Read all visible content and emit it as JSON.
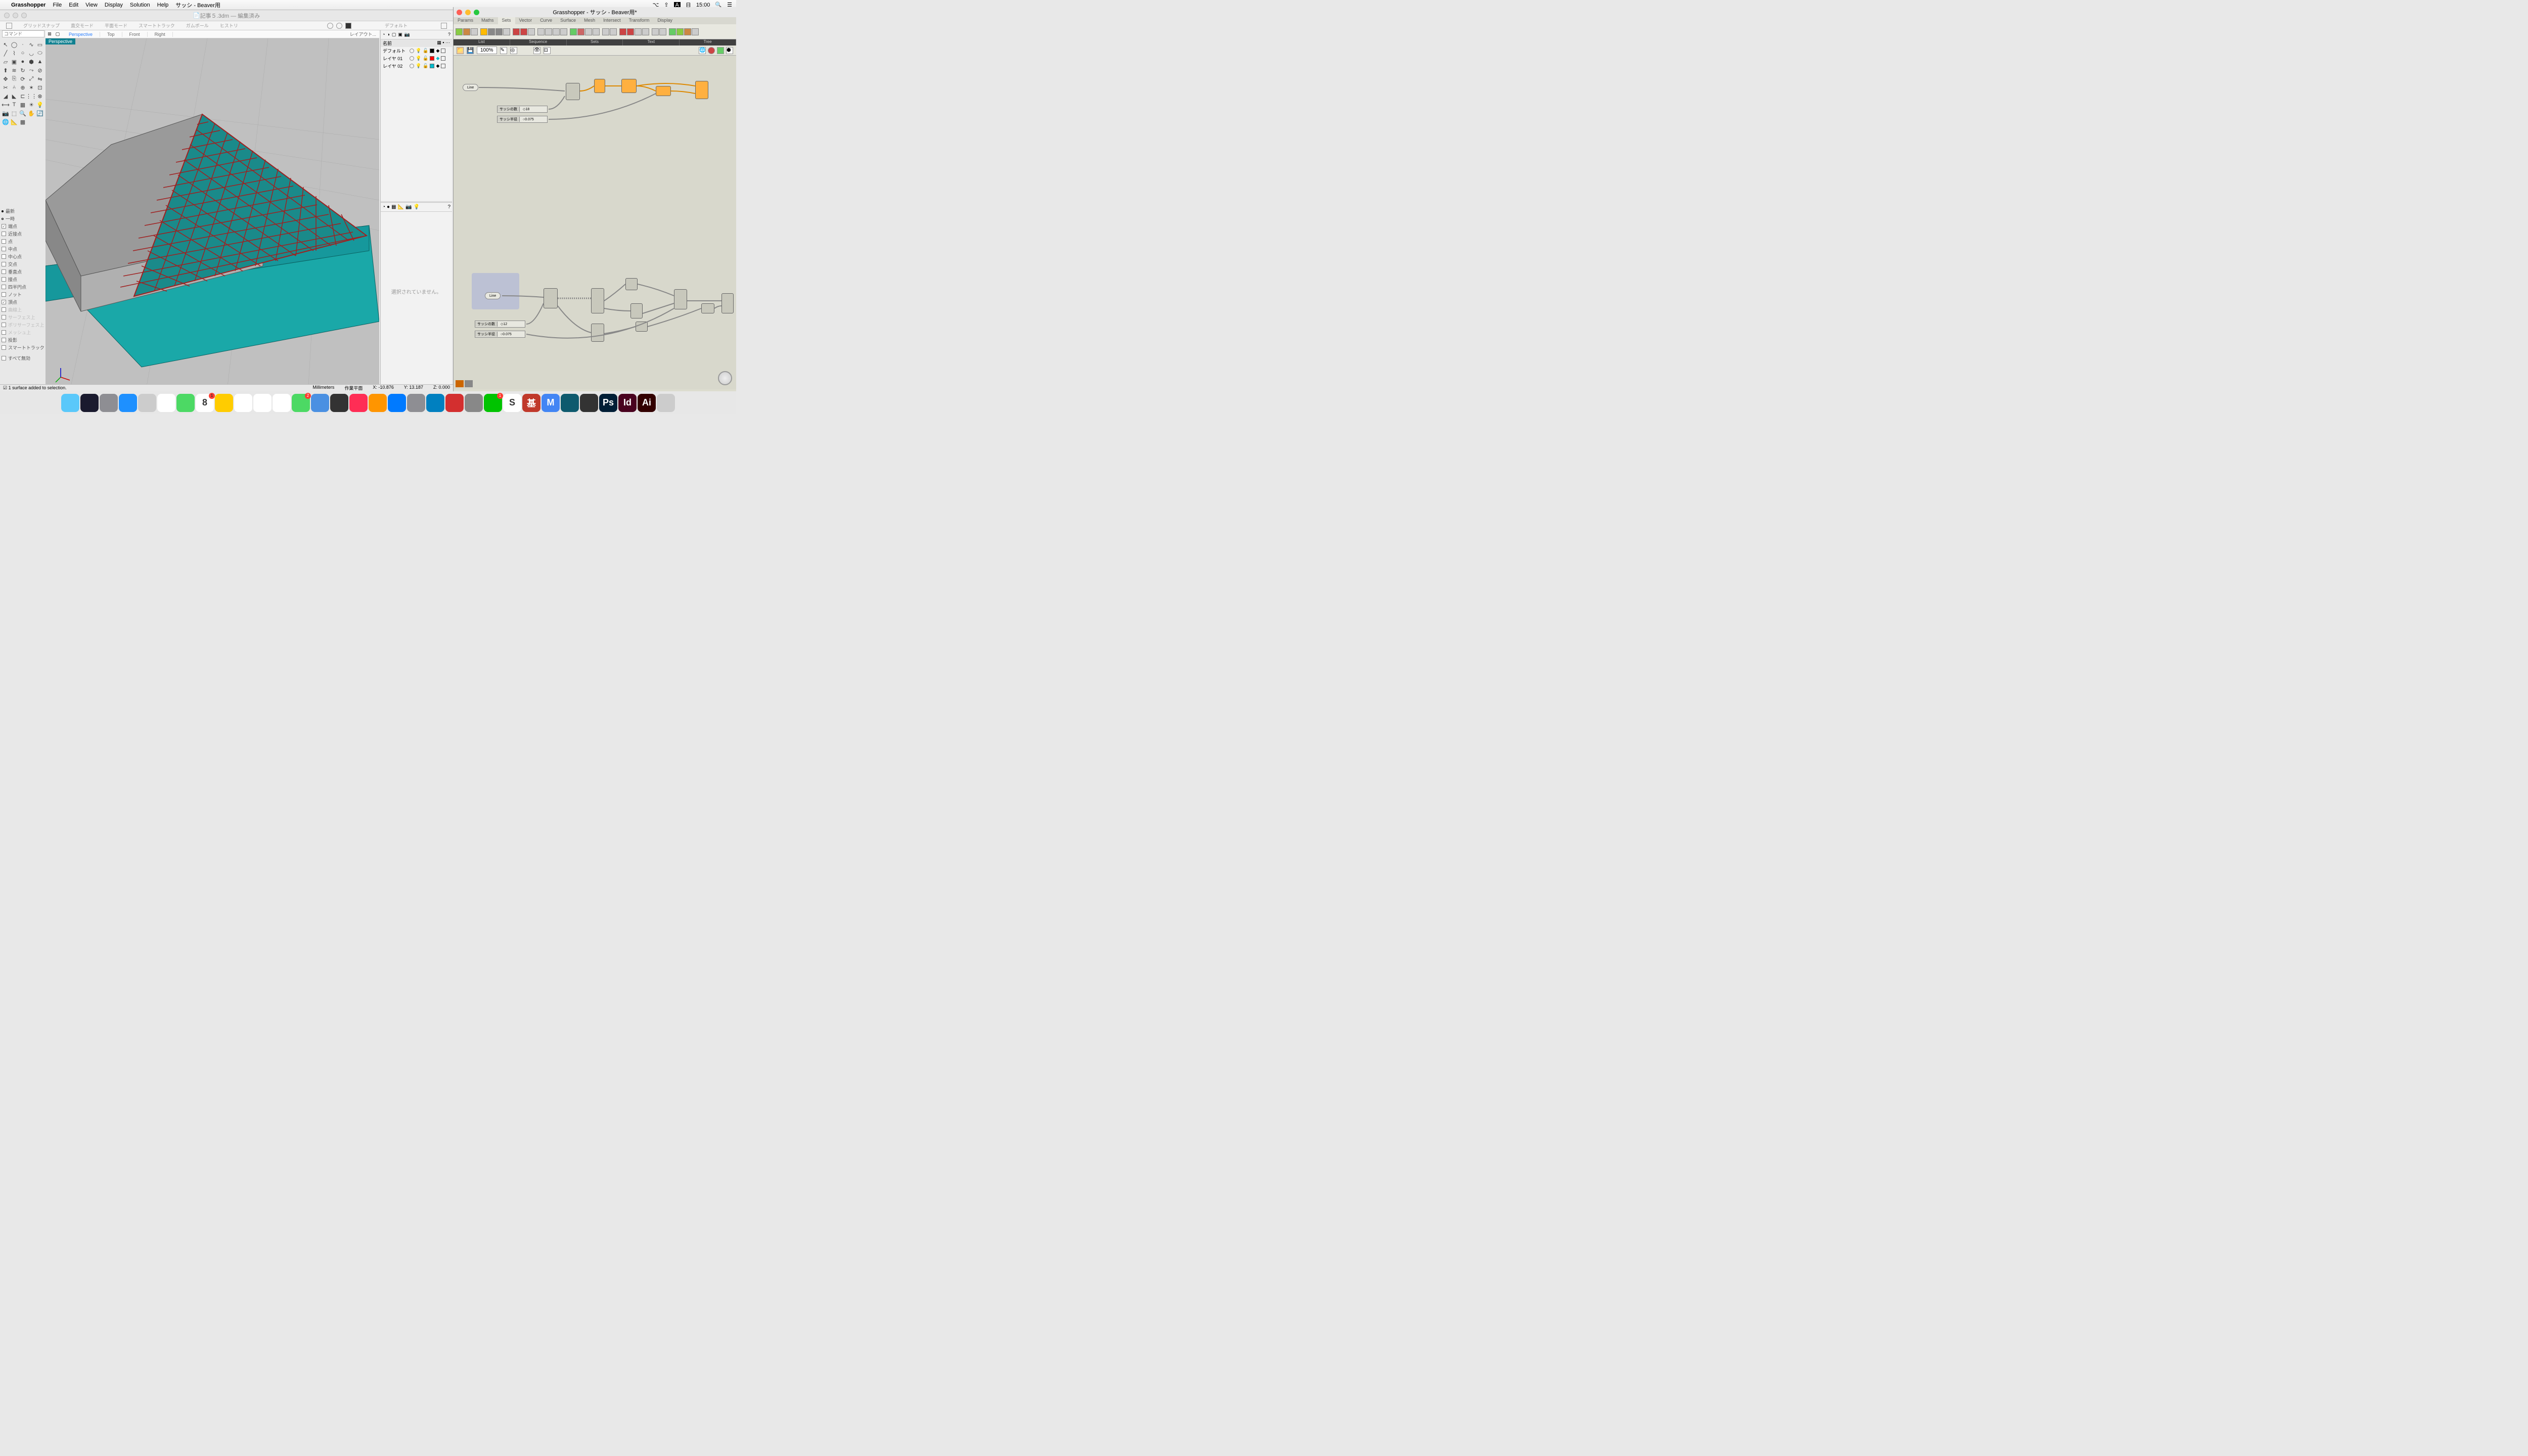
{
  "menubar": {
    "app": "Grasshopper",
    "items": [
      "File",
      "Edit",
      "View",
      "Display",
      "Solution",
      "Help",
      "サッシ - Beaver用"
    ],
    "day": "日",
    "time": "15:00"
  },
  "rhino": {
    "title": "記事５.3dm — 編集済み",
    "opts": [
      "グリッドスナップ",
      "直交モード",
      "平面モード",
      "スマートトラック",
      "ガムボール",
      "ヒストリ"
    ],
    "opts_right": "デフォルト",
    "cmd_placeholder": "コマンド",
    "viewport_label": "Perspective",
    "tabs": [
      "Perspective",
      "Top",
      "Front",
      "Right"
    ],
    "layout": "レイアウト..."
  },
  "layers": {
    "header": "名前",
    "rows": [
      {
        "name": "デフォルト",
        "color": "#000000"
      },
      {
        "name": "レイヤ 01",
        "color": "#ff0000"
      },
      {
        "name": "レイヤ 02",
        "color": "#00bcd4"
      }
    ]
  },
  "props": {
    "msg": "選択されていません。"
  },
  "osnap": {
    "items": [
      {
        "label": "最新",
        "checked": false,
        "dot": true
      },
      {
        "label": "一時",
        "checked": false,
        "dot": true
      },
      {
        "label": "端点",
        "checked": true
      },
      {
        "label": "近接点",
        "checked": false
      },
      {
        "label": "点",
        "checked": false
      },
      {
        "label": "中点",
        "checked": false
      },
      {
        "label": "中心点",
        "checked": false
      },
      {
        "label": "交点",
        "checked": false
      },
      {
        "label": "垂直点",
        "checked": false
      },
      {
        "label": "接点",
        "checked": false
      },
      {
        "label": "四半円点",
        "checked": false
      },
      {
        "label": "ノット",
        "checked": false
      },
      {
        "label": "頂点",
        "checked": true
      },
      {
        "label": "曲線上",
        "checked": false,
        "disabled": true
      },
      {
        "label": "サーフェス上",
        "checked": false,
        "disabled": true
      },
      {
        "label": "ポリサーフェス上",
        "checked": false,
        "disabled": true
      },
      {
        "label": "メッシュ上",
        "checked": false,
        "disabled": true
      },
      {
        "label": "投影",
        "checked": false
      },
      {
        "label": "スマートトラック",
        "checked": false
      }
    ],
    "all_off": "すべて無効"
  },
  "status": {
    "msg": "1 surface added to selection.",
    "units": "Millimeters",
    "plane": "作業平面",
    "x": "X: -10.876",
    "y": "Y: 13.187",
    "z": "Z: 0.000"
  },
  "gh": {
    "title": "Grasshopper - サッシ - Beaver用*",
    "tabs": [
      "Params",
      "Maths",
      "Sets",
      "Vector",
      "Curve",
      "Surface",
      "Mesh",
      "Intersect",
      "Transform",
      "Display"
    ],
    "active_tab": "Sets",
    "cats": [
      "List",
      "Sequence",
      "Sets",
      "Text",
      "Tree"
    ],
    "zoom": "100%",
    "params": {
      "line1": "Line",
      "line2": "Line",
      "slider1_label": "サッシの数",
      "slider1_val": "18",
      "slider2_label": "サッシ半径",
      "slider2_val": "0.075",
      "slider3_label": "サッシの数",
      "slider3_val": "12",
      "slider4_label": "サッシ半径",
      "slider4_val": "0.075"
    }
  },
  "dock": {
    "apps": [
      {
        "name": "finder",
        "bg": "#5ac8fa"
      },
      {
        "name": "siri",
        "bg": "#1a1a2e"
      },
      {
        "name": "launchpad",
        "bg": "#8e8e93"
      },
      {
        "name": "safari",
        "bg": "#1e90ff"
      },
      {
        "name": "preview",
        "bg": "#ccc"
      },
      {
        "name": "chrome",
        "bg": "#fff"
      },
      {
        "name": "maps",
        "bg": "#4cd964"
      },
      {
        "name": "calendar",
        "bg": "#fff",
        "text": "8",
        "badge": "1"
      },
      {
        "name": "notes",
        "bg": "#ffcc00"
      },
      {
        "name": "reminders",
        "bg": "#fff"
      },
      {
        "name": "gmaps",
        "bg": "#fff"
      },
      {
        "name": "photos",
        "bg": "#fff"
      },
      {
        "name": "messages",
        "bg": "#4cd964",
        "badge": "2"
      },
      {
        "name": "earth",
        "bg": "#4a90e2"
      },
      {
        "name": "fcp",
        "bg": "#333"
      },
      {
        "name": "itunes",
        "bg": "#ff2d55"
      },
      {
        "name": "ibooks",
        "bg": "#ff9500"
      },
      {
        "name": "appstore",
        "bg": "#007aff"
      },
      {
        "name": "settings",
        "bg": "#8e8e93"
      },
      {
        "name": "archicad",
        "bg": "#0080c0"
      },
      {
        "name": "sketchup",
        "bg": "#d32f2f"
      },
      {
        "name": "gh",
        "bg": "#888"
      },
      {
        "name": "line",
        "bg": "#00c300",
        "badge": "1"
      },
      {
        "name": "slack",
        "bg": "#fff",
        "text": "S"
      },
      {
        "name": "k",
        "bg": "#c0392b",
        "text": "基"
      },
      {
        "name": "word",
        "bg": "#4285f4",
        "text": "M"
      },
      {
        "name": "maya",
        "bg": "#0e5a6e"
      },
      {
        "name": "c4d",
        "bg": "#333"
      },
      {
        "name": "ps",
        "bg": "#001e36",
        "text": "Ps"
      },
      {
        "name": "id",
        "bg": "#49021f",
        "text": "Id"
      },
      {
        "name": "ai",
        "bg": "#330000",
        "text": "Ai"
      },
      {
        "name": "trash",
        "bg": "#ccc"
      }
    ]
  }
}
